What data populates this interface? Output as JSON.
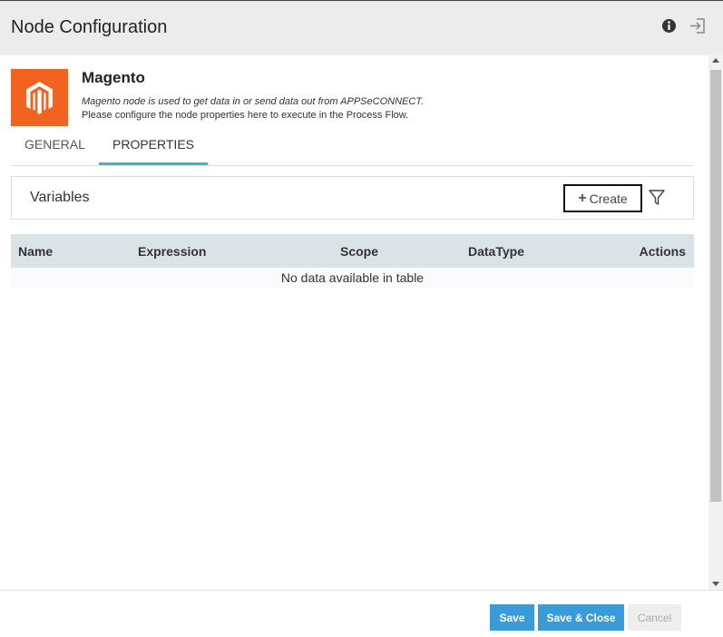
{
  "header": {
    "title": "Node Configuration",
    "info_icon": "info-circle-icon",
    "exit_icon": "sign-out-icon"
  },
  "node": {
    "name": "Magento",
    "description": "Magento node is used to get data in or send data out from APPSeCONNECT.",
    "instructions": "Please configure the node properties here to execute in the Process Flow.",
    "logo_color": "#f26322"
  },
  "tabs": [
    {
      "label": "GENERAL",
      "active": false
    },
    {
      "label": "PROPERTIES",
      "active": true
    }
  ],
  "variables": {
    "title": "Variables",
    "create_label": "Create",
    "filter_icon": "filter-icon"
  },
  "table": {
    "columns": [
      "Name",
      "Expression",
      "Scope",
      "DataType",
      "Actions"
    ],
    "empty_message": "No data available in table"
  },
  "footer": {
    "save_label": "Save",
    "save_close_label": "Save & Close",
    "cancel_label": "Cancel"
  },
  "colors": {
    "accent": "#3db5cf",
    "primary_button": "#3b9ad9",
    "header_bg": "#ececec"
  }
}
